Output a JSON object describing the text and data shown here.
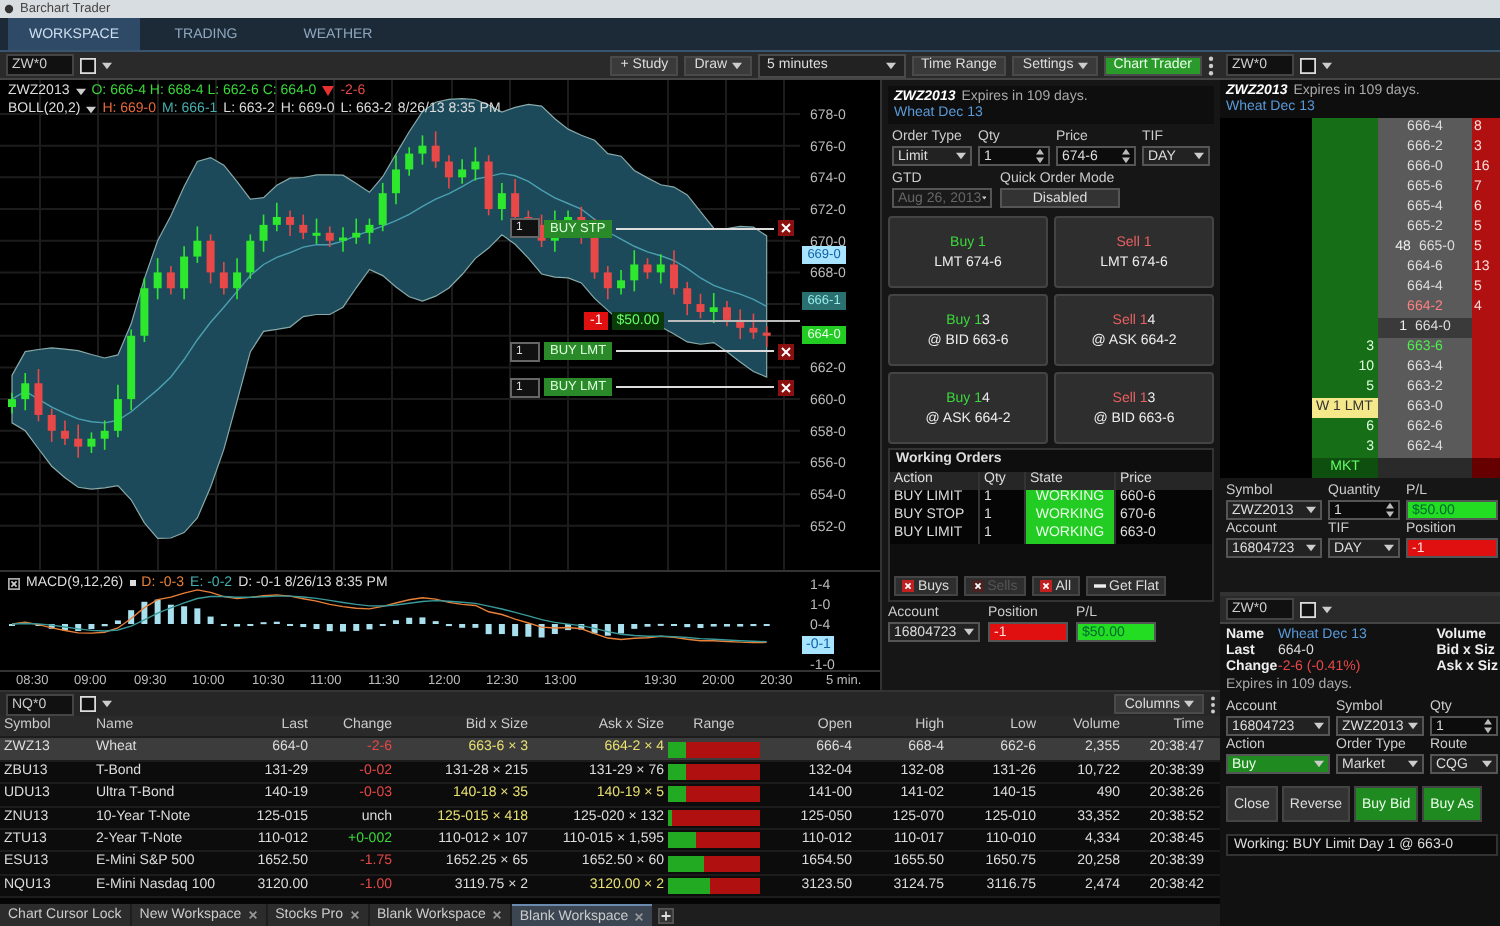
{
  "window": {
    "title": "Barchart Trader"
  },
  "nav_tabs": [
    {
      "label": "WORKSPACE",
      "selected": true
    },
    {
      "label": "TRADING",
      "selected": false
    },
    {
      "label": "WEATHER",
      "selected": false
    }
  ],
  "chart_widget": {
    "symbol_field": "ZW*0",
    "study": "+ Study",
    "draw": "Draw",
    "interval": "5 minutes",
    "time_range": "Time Range",
    "settings": "Settings",
    "chart_trader": "Chart Trader",
    "legend": {
      "symbol": "ZWZ2013",
      "ohlc": "O: 666-4 H: 668-4 L: 662-6 C: 664-0",
      "change": "-2-6"
    },
    "boll": {
      "name": "BOLL(20,2)",
      "values": [
        {
          "text": "H: 669-0",
          "kind": "upper"
        },
        {
          "text": "M: 666-1",
          "kind": "middle"
        },
        {
          "text": "L: 663-2",
          "kind": "plain"
        },
        {
          "text": "H: 669-0",
          "kind": "plain"
        },
        {
          "text": "L: 663-2",
          "kind": "plain"
        },
        {
          "text": "8/26/13 8:35 PM",
          "kind": "plain"
        }
      ]
    },
    "price_axis": [
      "678-0",
      "676-0",
      "674-0",
      "672-0",
      "670-0",
      "668-0",
      "662-0",
      "660-0",
      "658-0",
      "656-0",
      "654-0",
      "652-0"
    ],
    "price_tags": [
      {
        "text": "669-0",
        "kind": "upper"
      },
      {
        "text": "666-1",
        "kind": "middle"
      },
      {
        "text": "664-0",
        "kind": "last"
      }
    ],
    "order_lines": [
      {
        "qty": "1",
        "label": "BUY STP"
      },
      {
        "qty": "1",
        "label": "BUY LMT"
      },
      {
        "qty": "1",
        "label": "BUY LMT"
      }
    ],
    "position_line": {
      "qty": "-1",
      "pl": "$50.00"
    },
    "macd": {
      "name": "MACD(9,12,26)",
      "values": [
        {
          "text": "D: -0-3",
          "kind": "macd"
        },
        {
          "text": "E: -0-2",
          "kind": "signal"
        },
        {
          "text": "D: -0-1 8/26/13 8:35 PM",
          "kind": "plain"
        }
      ],
      "axis": [
        "1-4",
        "1-0",
        "0-4",
        "-1-0"
      ],
      "tag": "-0-1"
    },
    "time_axis": [
      "08:30",
      "09:00",
      "09:30",
      "10:00",
      "10:30",
      "11:00",
      "11:30",
      "12:00",
      "12:30",
      "13:00",
      "19:30",
      "20:00",
      "20:30"
    ],
    "interval_label": "5 min."
  },
  "order_ticket": {
    "contract": "ZWZ2013",
    "expires": "Expires in 109 days.",
    "name": "Wheat Dec 13",
    "fields": [
      {
        "label": "Order Type",
        "value": "Limit",
        "kind": "select"
      },
      {
        "label": "Qty",
        "value": "1",
        "kind": "spinner"
      },
      {
        "label": "Price",
        "value": "674-6",
        "kind": "spinner"
      },
      {
        "label": "TIF",
        "value": "DAY",
        "kind": "select"
      }
    ],
    "gtd": {
      "label": "GTD",
      "value": "Aug 26, 2013",
      "disabled": true
    },
    "quick_mode": {
      "label": "Quick Order Mode",
      "value": "Disabled"
    },
    "quick_buttons": [
      {
        "kind": "buy",
        "action": "Buy 1",
        "detail": "LMT 674-6"
      },
      {
        "kind": "sell",
        "action": "Sell 1",
        "detail": "LMT 674-6"
      },
      {
        "kind": "buy",
        "action": "Buy 1",
        "count": "3",
        "detail": "@ BID 663-6"
      },
      {
        "kind": "sell",
        "action": "Sell 1",
        "count": "4",
        "detail": "@ ASK 664-2"
      },
      {
        "kind": "buy",
        "action": "Buy 1",
        "count": "4",
        "detail": "@ ASK 664-2"
      },
      {
        "kind": "sell",
        "action": "Sell 1",
        "count": "3",
        "detail": "@ BID 663-6"
      }
    ],
    "working_orders": {
      "title": "Working Orders",
      "columns": [
        "Action",
        "Qty",
        "State",
        "Price"
      ],
      "rows": [
        {
          "action": "BUY LIMIT",
          "qty": "1",
          "state": "WORKING",
          "price": "660-6"
        },
        {
          "action": "BUY STOP",
          "qty": "1",
          "state": "WORKING",
          "price": "670-6"
        },
        {
          "action": "BUY LIMIT",
          "qty": "1",
          "state": "WORKING",
          "price": "663-0"
        }
      ]
    },
    "cancel_buttons": [
      {
        "label": "Buys",
        "disabled": false,
        "kind": "cancel"
      },
      {
        "label": "Sells",
        "disabled": true,
        "kind": "cancel"
      },
      {
        "label": "All",
        "disabled": false,
        "kind": "cancel"
      },
      {
        "label": "Get Flat",
        "disabled": false,
        "kind": "flat"
      }
    ],
    "account": {
      "label": "Account",
      "value": "16804723"
    },
    "position": {
      "label": "Position",
      "value": "-1"
    },
    "pl": {
      "label": "P/L",
      "value": "$50.00"
    }
  },
  "dom": {
    "symbol_field": "ZW*0",
    "contract": "ZWZ2013",
    "expires": "Expires in 109 days.",
    "name": "Wheat Dec 13",
    "ladder": [
      {
        "price": "666-4",
        "ask": "8",
        "kind": "normal",
        "working": false
      },
      {
        "price": "666-2",
        "ask": "3",
        "kind": "normal",
        "working": false
      },
      {
        "price": "666-0",
        "ask": "16",
        "kind": "normal",
        "working": false
      },
      {
        "price": "665-6",
        "ask": "7",
        "kind": "normal",
        "working": false
      },
      {
        "price": "665-4",
        "ask": "6",
        "kind": "normal",
        "working": false
      },
      {
        "price": "665-2",
        "ask": "5",
        "kind": "normal",
        "working": false
      },
      {
        "price": "665-0",
        "volume": "48",
        "ask": "5",
        "kind": "normal",
        "working": false
      },
      {
        "price": "664-6",
        "ask": "13",
        "kind": "normal",
        "working": false
      },
      {
        "price": "664-4",
        "ask": "5",
        "kind": "normal",
        "working": false
      },
      {
        "price": "664-2",
        "ask": "4",
        "kind": "best_ask",
        "working": false
      },
      {
        "price": "664-0",
        "volume": "1",
        "kind": "last",
        "working": false
      },
      {
        "price": "663-6",
        "bid": "3",
        "kind": "best_bid",
        "working": false
      },
      {
        "price": "663-4",
        "bid": "10",
        "kind": "normal",
        "working": false
      },
      {
        "price": "663-2",
        "bid": "5",
        "kind": "normal",
        "working": false
      },
      {
        "price": "663-0",
        "bid": "W 1 LMT",
        "kind": "normal",
        "working": true
      },
      {
        "price": "662-6",
        "bid": "6",
        "kind": "normal",
        "working": false
      },
      {
        "price": "662-4",
        "bid": "3",
        "kind": "normal",
        "working": false
      }
    ],
    "market_label": "MKT",
    "form": [
      {
        "label": "Symbol",
        "value": "ZWZ2013",
        "kind": "select"
      },
      {
        "label": "Quantity",
        "value": "1",
        "kind": "spinner"
      },
      {
        "label": "P/L",
        "value": "$50.00",
        "kind": "profit"
      },
      {
        "label": "Account",
        "value": "16804723",
        "kind": "select"
      },
      {
        "label": "TIF",
        "value": "DAY",
        "kind": "select"
      },
      {
        "label": "Position",
        "value": "-1",
        "kind": "loss"
      }
    ]
  },
  "quote_ticket": {
    "symbol_field": "ZW*0",
    "info": [
      {
        "label": "Name",
        "value": "Wheat Dec 13",
        "kind": "name"
      },
      {
        "label": "Last",
        "value": "664-0",
        "kind": "plain"
      },
      {
        "label": "Change",
        "value": "-2-6 (-0.41%)",
        "kind": "down"
      }
    ],
    "stats": [
      "Volume",
      "Bid x Siz",
      "Ask x Siz"
    ],
    "expires": "Expires in 109 days.",
    "fields": [
      {
        "label": "Account",
        "value": "16804723",
        "kind": "select"
      },
      {
        "label": "Symbol",
        "value": "ZWZ2013",
        "kind": "select"
      },
      {
        "label": "Qty",
        "value": "1",
        "kind": "spinner"
      },
      {
        "label": "Action",
        "value": "Buy",
        "kind": "buy"
      },
      {
        "label": "Order Type",
        "value": "Market",
        "kind": "select"
      },
      {
        "label": "Route",
        "value": "CQG",
        "kind": "select"
      }
    ],
    "buttons": [
      {
        "label": "Close",
        "kind": "plain"
      },
      {
        "label": "Reverse",
        "kind": "plain"
      },
      {
        "label": "Buy Bid",
        "kind": "buy"
      },
      {
        "label": "Buy As",
        "kind": "buy"
      }
    ],
    "working": "Working: BUY Limit Day 1 @ 663-0"
  },
  "quotes": {
    "symbol_field": "NQ*0",
    "columns_button": "Columns",
    "columns": [
      "Symbol",
      "Name",
      "Last",
      "Change",
      "Bid x Size",
      "Ask x Size",
      "Range",
      "Open",
      "High",
      "Low",
      "Volume",
      "Time"
    ],
    "rows": [
      {
        "symbol": "ZWZ13",
        "name": "Wheat",
        "last": "664-0",
        "change": "-2-6",
        "kind": "down",
        "bid": "663-6 × 3",
        "bid_highlighted": true,
        "ask": "664-2 × 4",
        "ask_highlighted": true,
        "level": 0.2,
        "open": "666-4",
        "high": "668-4",
        "low": "662-6",
        "volume": "2,355",
        "time": "20:38:47",
        "selected": true
      },
      {
        "symbol": "ZBU13",
        "name": "T-Bond",
        "last": "131-29",
        "change": "-0-02",
        "kind": "down",
        "bid": "131-28 × 215",
        "bid_highlighted": false,
        "ask": "131-29 × 76",
        "ask_highlighted": false,
        "level": 0.2,
        "open": "132-04",
        "high": "132-08",
        "low": "131-26",
        "volume": "10,722",
        "time": "20:38:39",
        "selected": false
      },
      {
        "symbol": "UDU13",
        "name": "Ultra T-Bond",
        "last": "140-19",
        "change": "-0-03",
        "kind": "down",
        "bid": "140-18 × 35",
        "bid_highlighted": true,
        "ask": "140-19 × 5",
        "ask_highlighted": true,
        "level": 0.2,
        "open": "141-00",
        "high": "141-02",
        "low": "140-15",
        "volume": "490",
        "time": "20:38:26",
        "selected": false
      },
      {
        "symbol": "ZNU13",
        "name": "10-Year T-Note",
        "last": "125-015",
        "change": "unch",
        "kind": "flat",
        "bid": "125-015 × 418",
        "bid_highlighted": true,
        "ask": "125-020 × 132",
        "ask_highlighted": false,
        "level": 0.05,
        "open": "125-050",
        "high": "125-070",
        "low": "125-010",
        "volume": "33,352",
        "time": "20:38:52",
        "selected": false
      },
      {
        "symbol": "ZTU13",
        "name": "2-Year T-Note",
        "last": "110-012",
        "change": "+0-002",
        "kind": "up",
        "bid": "110-012 × 107",
        "bid_highlighted": false,
        "ask": "110-015 × 1,595",
        "ask_highlighted": false,
        "level": 0.3,
        "open": "110-012",
        "high": "110-017",
        "low": "110-010",
        "volume": "4,334",
        "time": "20:38:45",
        "selected": false
      },
      {
        "symbol": "ESU13",
        "name": "E-Mini S&P 500",
        "last": "1652.50",
        "change": "-1.75",
        "kind": "down",
        "bid": "1652.25 × 65",
        "bid_highlighted": false,
        "ask": "1652.50 × 60",
        "ask_highlighted": false,
        "level": 0.4,
        "open": "1654.50",
        "high": "1655.50",
        "low": "1650.75",
        "volume": "20,258",
        "time": "20:38:39",
        "selected": false
      },
      {
        "symbol": "NQU13",
        "name": "E-Mini Nasdaq 100",
        "last": "3120.00",
        "change": "-1.00",
        "kind": "down",
        "bid": "3119.75 × 2",
        "bid_highlighted": false,
        "ask": "3120.00 × 2",
        "ask_highlighted": true,
        "level": 0.45,
        "open": "3123.50",
        "high": "3124.75",
        "low": "3116.75",
        "volume": "2,474",
        "time": "20:38:42",
        "selected": false
      }
    ]
  },
  "workspace_tabs": [
    {
      "label": "Chart Cursor Lock",
      "closable": false,
      "selected": false
    },
    {
      "label": "New Workspace",
      "closable": true,
      "selected": false
    },
    {
      "label": "Stocks Pro",
      "closable": true,
      "selected": false
    },
    {
      "label": "Blank Workspace",
      "closable": true,
      "selected": false
    },
    {
      "label": "Blank Workspace",
      "closable": true,
      "selected": true
    }
  ]
}
